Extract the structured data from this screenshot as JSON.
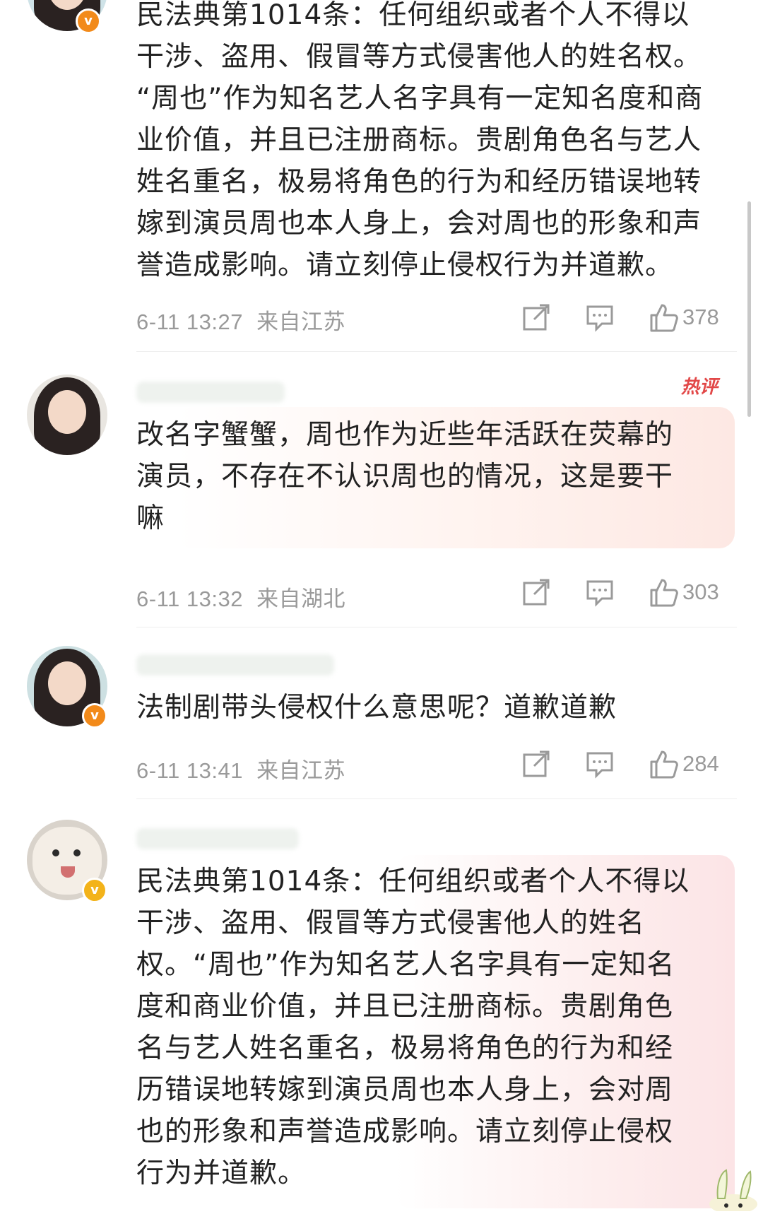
{
  "comments": [
    {
      "text": "民法典第1014条：任何组织或者个人不得以\n干涉、盗用、假冒等方式侵害他人的姓名权。\n“周也”作为知名艺人名字具有一定知名度和商\n业价值，并且已注册商标。贵剧角色名与艺人\n姓名重名，极易将角色的行为和经历错误地转\n嫁到演员周也本人身上，会对周也的形象和声\n誉造成影响。请立刻停止侵权行为并道歉。",
      "time": "6-11 13:27",
      "location": "来自江苏",
      "likes": "378",
      "badge": "v"
    },
    {
      "text": "改名字蟹蟹，周也作为近些年活跃在荧幕的\n演员，不存在不认识周也的情况，这是要干\n嘛",
      "time": "6-11 13:32",
      "location": "来自湖北",
      "likes": "303",
      "tag": "热评"
    },
    {
      "text": "法制剧带头侵权什么意思呢？道歉道歉",
      "time": "6-11 13:41",
      "location": "来自江苏",
      "likes": "284",
      "badge": "v"
    },
    {
      "text": "民法典第1014条：任何组织或者个人不得以\n干涉、盗用、假冒等方式侵害他人的姓名\n权。“周也”作为知名艺人名字具有一定知名\n度和商业价值，并且已注册商标。贵剧角色\n名与艺人姓名重名，极易将角色的行为和经\n历错误地转嫁到演员周也本人身上，会对周\n也的形象和声誉造成影响。请立刻停止侵权\n行为并道歉。",
      "badge": "v"
    }
  ],
  "colors": {
    "text": "#222222",
    "meta": "#9a9a9a",
    "hot_tag": "#e24848",
    "badge_orange": "#f28a1a",
    "badge_gold": "#f3b31a"
  },
  "icons": {
    "repost": "repost-icon",
    "reply": "comment-icon",
    "like": "thumbs-up-icon"
  }
}
